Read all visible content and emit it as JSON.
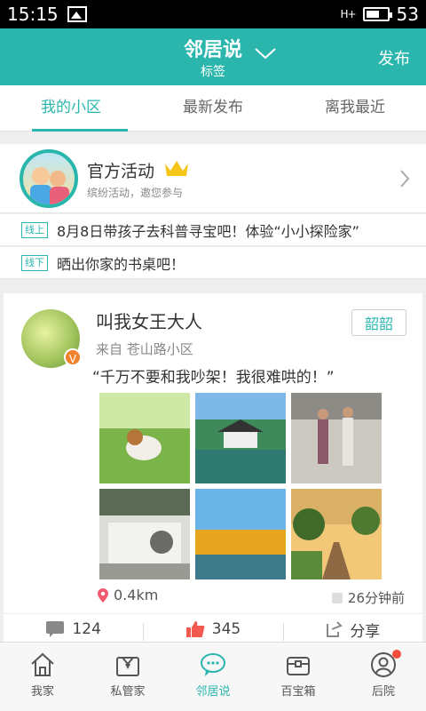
{
  "status_bar": {
    "time": "15:15",
    "signal": "H+",
    "battery": "53"
  },
  "header": {
    "title": "邻居说",
    "subtitle": "标签",
    "publish_label": "发布"
  },
  "tabs": [
    {
      "label": "我的小区",
      "active": true
    },
    {
      "label": "最新发布",
      "active": false
    },
    {
      "label": "离我最近",
      "active": false
    }
  ],
  "official": {
    "title": "官方活动",
    "desc": "缤纷活动，邀您参与"
  },
  "announcements": [
    {
      "tag": "线上",
      "text": "8月8日带孩子去科普寻宝吧！体验“小小探险家”"
    },
    {
      "tag": "线下",
      "text": "晒出你家的书桌吧！"
    }
  ],
  "post": {
    "user": "叫我女王大人",
    "from": "来自 苍山路小区",
    "badge": "韶韶",
    "quote": "“千万不要和我吵架！我很难哄的！”",
    "distance": "0.4km",
    "time": "26分钟前",
    "comments": "124",
    "likes": "345",
    "share": "分享",
    "photo_icons": [
      "dog-on-lawn",
      "chinese-pavilion",
      "dancing-elders",
      "courtyard-gate",
      "autumn-trees-lake",
      "tree-lined-road"
    ]
  },
  "bottom_nav": [
    {
      "label": "我家",
      "icon": "home-icon",
      "active": false
    },
    {
      "label": "私管家",
      "icon": "butler-icon",
      "active": false
    },
    {
      "label": "邻居说",
      "icon": "chat-icon",
      "active": true
    },
    {
      "label": "百宝箱",
      "icon": "treasure-box-icon",
      "active": false
    },
    {
      "label": "后院",
      "icon": "profile-icon",
      "active": false,
      "dot": true
    }
  ],
  "colors": {
    "accent": "#2bb6ad",
    "badge_orange": "#f0822d",
    "red_dot": "#f24b3a"
  }
}
